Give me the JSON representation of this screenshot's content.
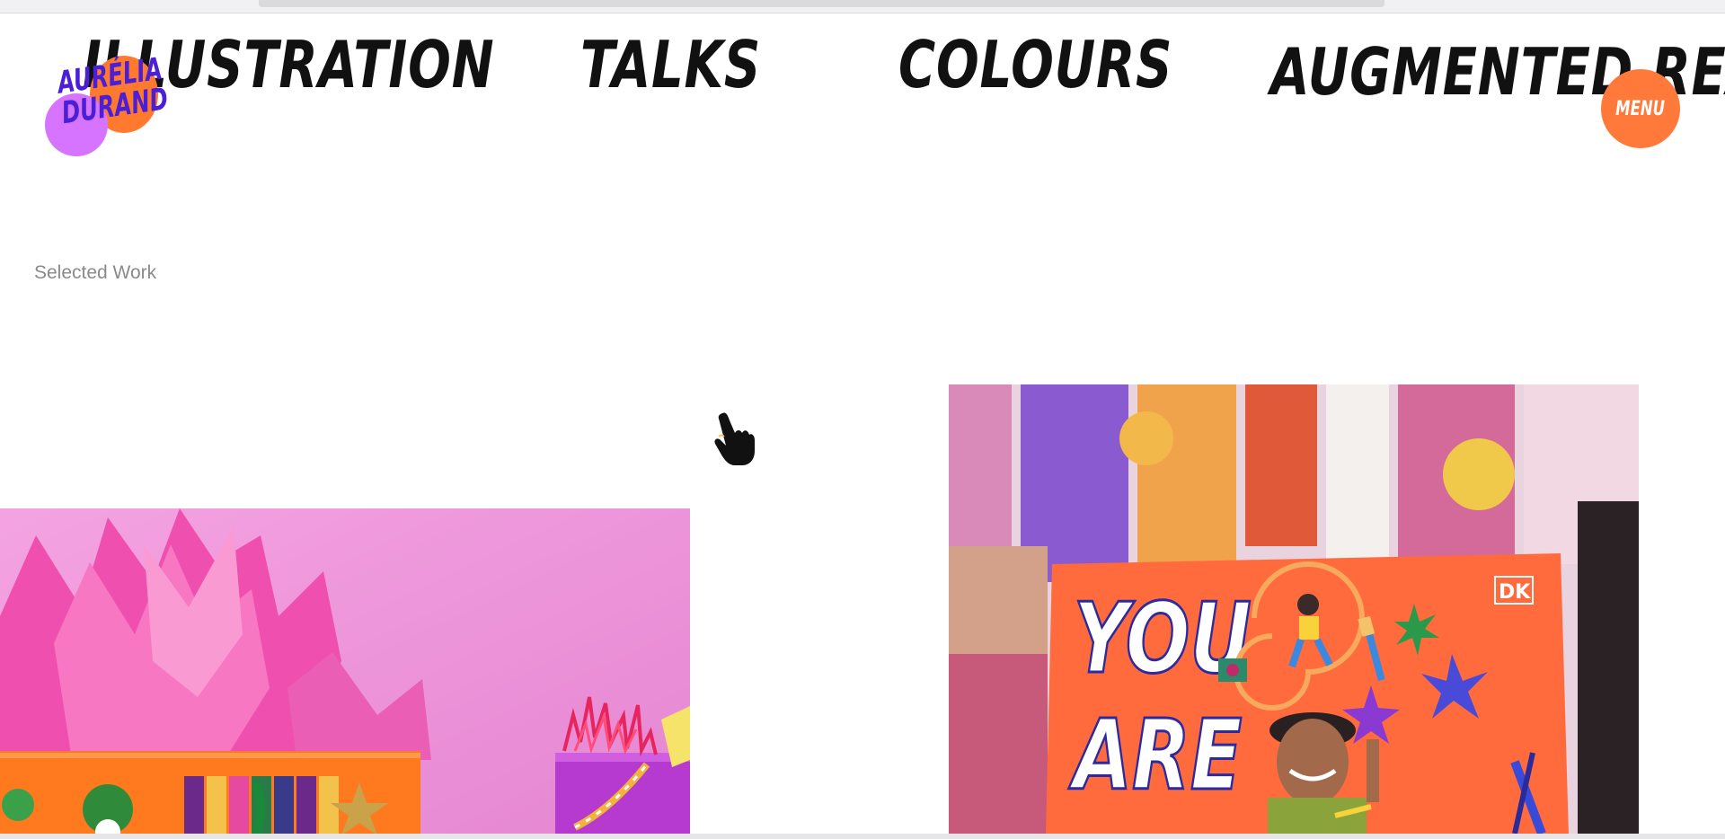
{
  "marquee": {
    "items": [
      "ILLUSTRATION",
      "TALKS",
      "COLOURS",
      "AUGMENTED REALITY"
    ]
  },
  "logo": {
    "line1": "AURÉLIA",
    "line2": "DURAND"
  },
  "menu": {
    "label": "MENU"
  },
  "section": {
    "label": "Selected Work"
  },
  "right_card": {
    "cover_word1": "YOU",
    "cover_word2": "ARE",
    "publisher_badge": "DK"
  },
  "colors": {
    "accent_orange": "#ff7a3a",
    "logo_purple": "#4a1fd6",
    "logo_pink": "#d673ff",
    "card_pink": "#ec8ad4"
  },
  "icons": {
    "cursor": "pointer-hand-icon"
  }
}
